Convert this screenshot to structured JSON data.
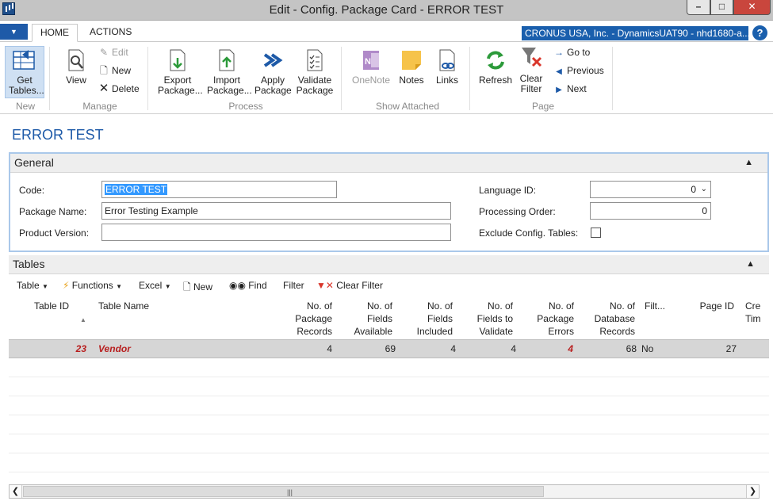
{
  "window": {
    "title": "Edit - Config. Package Card - ERROR TEST"
  },
  "tabs": {
    "home": "HOME",
    "actions": "ACTIONS"
  },
  "company": "CRONUS USA, Inc. - DynamicsUAT90 - nhd1680-a...",
  "ribbon": {
    "new": {
      "get_tables": "Get Tables...",
      "group": "New"
    },
    "manage": {
      "view": "View",
      "edit": "Edit",
      "new": "New",
      "delete": "Delete",
      "group": "Manage"
    },
    "process": {
      "export": "Export Package...",
      "import": "Import Package...",
      "apply": "Apply Package",
      "validate": "Validate Package",
      "group": "Process"
    },
    "attached": {
      "onenote": "OneNote",
      "notes": "Notes",
      "links": "Links",
      "group": "Show Attached"
    },
    "page": {
      "refresh": "Refresh",
      "clear_filter": "Clear Filter",
      "goto": "Go to",
      "previous": "Previous",
      "next": "Next",
      "group": "Page"
    }
  },
  "page_title": "ERROR TEST",
  "general": {
    "header": "General",
    "code_label": "Code:",
    "code_value": "ERROR TEST",
    "name_label": "Package Name:",
    "name_value": "Error Testing Example",
    "version_label": "Product Version:",
    "version_value": "",
    "lang_label": "Language ID:",
    "lang_value": "0",
    "order_label": "Processing Order:",
    "order_value": "0",
    "exclude_label": "Exclude Config. Tables:"
  },
  "tables": {
    "header": "Tables",
    "toolbar": {
      "table": "Table",
      "functions": "Functions",
      "excel": "Excel",
      "new": "New",
      "find": "Find",
      "filter": "Filter",
      "clear_filter": "Clear Filter"
    },
    "columns": {
      "table_id": "Table ID",
      "table_name": "Table Name",
      "pkg_records": "No. of Package Records",
      "fields_avail": "No. of Fields Available",
      "fields_incl": "No. of Fields Included",
      "fields_validate": "No. of Fields to Validate",
      "pkg_errors": "No. of Package Errors",
      "db_records": "No. of Database Records",
      "filt": "Filt...",
      "page_id": "Page ID",
      "cre": "Cre Tim"
    },
    "rows": [
      {
        "table_id": "23",
        "table_name": "Vendor",
        "pkg_records": "4",
        "fields_avail": "69",
        "fields_incl": "4",
        "fields_validate": "4",
        "pkg_errors": "4",
        "db_records": "68",
        "filt": "No",
        "page_id": "27"
      }
    ]
  },
  "colors": {
    "accent": "#1e5aa8",
    "error": "#b81f1f",
    "selected_row": "#d6d6d6"
  }
}
